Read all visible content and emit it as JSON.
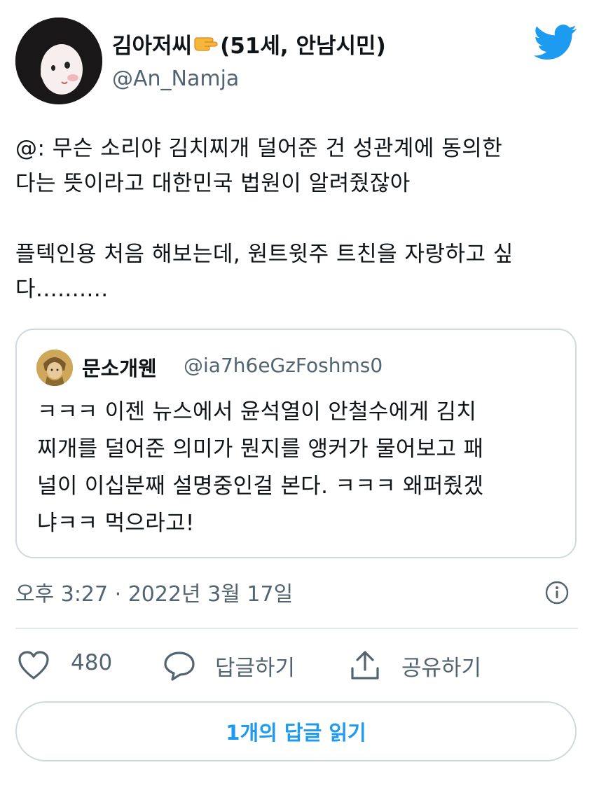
{
  "author": {
    "name_before_emoji": "김아저씨",
    "emoji": "pointing-hand-emoji",
    "name_after_emoji": "(51세, 안남시민)",
    "handle": "@An_Namja"
  },
  "tweet": {
    "lines": [
      "@: 무슨 소리야 김치찌개 덜어준 건 성관계에 동의한",
      "다는 뜻이라고 대한민국 법원이 알려줬잖아",
      "",
      "플텍인용 처음 해보는데, 원트윗주 트친을 자랑하고 싶",
      "다.........."
    ]
  },
  "quoted": {
    "name": "문소개웬",
    "handle": "@ia7h6eGzFoshms0",
    "lines": [
      "ㅋㅋㅋ 이젠 뉴스에서 윤석열이 안철수에게 김치",
      "찌개를 덜어준 의미가 뭔지를 앵커가 물어보고 패",
      "널이 이십분째 설명중인걸 본다. ㅋㅋㅋ 왜퍼줬겠",
      "냐ㅋㅋ 먹으라고!"
    ]
  },
  "meta": {
    "timestamp": "오후 3:27 · 2022년 3월 17일"
  },
  "actions": {
    "like_count": "480",
    "reply_label": "답글하기",
    "share_label": "공유하기"
  },
  "read_replies_label": "1개의 답글 읽기",
  "colors": {
    "brand_blue": "#1d9bf0",
    "muted_text": "#536471",
    "border": "#cfd9de"
  },
  "icons": [
    "twitter-bird-icon",
    "info-icon",
    "heart-icon",
    "reply-bubble-icon",
    "share-icon"
  ]
}
